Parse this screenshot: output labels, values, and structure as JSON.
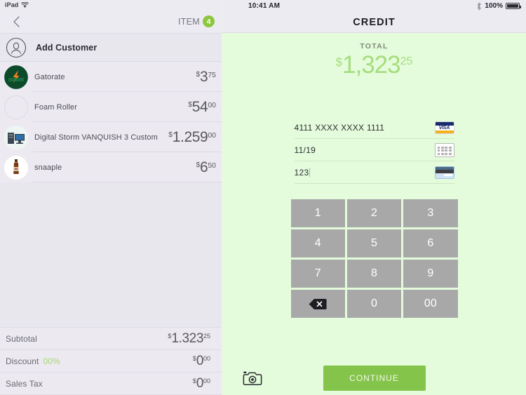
{
  "left_panel": {
    "status": {
      "device": "iPad",
      "wifi_icon": "wifi-icon"
    },
    "header": {
      "back_icon": "chevron-left-icon",
      "item_label": "ITEM",
      "item_count": "4"
    },
    "add_customer": {
      "label": "Add Customer",
      "icon": "person-circle-icon"
    },
    "cart_items": [
      {
        "name": "Gatorate",
        "currency": "$",
        "amount": "3",
        "cents": "75",
        "thumb": "gatorade-logo-thumb"
      },
      {
        "name": "Foam Roller",
        "currency": "$",
        "amount": "54",
        "cents": "00",
        "thumb": "empty-circle-thumb"
      },
      {
        "name": "Digital Storm VANQUISH 3 Custom",
        "currency": "$",
        "amount": "1.259",
        "cents": "00",
        "thumb": "desktop-pc-thumb"
      },
      {
        "name": "snaaple",
        "currency": "$",
        "amount": "6",
        "cents": "50",
        "thumb": "bottle-thumb"
      }
    ],
    "totals": [
      {
        "label": "Subtotal",
        "extra": "",
        "currency": "$",
        "amount": "1.323",
        "cents": "25"
      },
      {
        "label": "Discount",
        "extra": "00%",
        "currency": "$",
        "amount": "0",
        "cents": "00"
      },
      {
        "label": "Sales Tax",
        "extra": "",
        "currency": "$",
        "amount": "0",
        "cents": "00"
      }
    ]
  },
  "right_panel": {
    "status": {
      "time": "10:41 AM",
      "bluetooth_icon": "bluetooth-icon",
      "battery_percent": "100%"
    },
    "title": "CREDIT",
    "total": {
      "caption": "TOTAL",
      "currency": "$",
      "amount": "1,323",
      "cents": "25"
    },
    "fields": [
      {
        "value": "4111 XXXX XXXX 1111",
        "icon": "visa-card-icon",
        "has_cursor": false
      },
      {
        "value": "11/19",
        "icon": "calendar-icon",
        "has_cursor": false
      },
      {
        "value": "123",
        "icon": "card-back-cvv-icon",
        "has_cursor": true
      }
    ],
    "keypad": [
      {
        "label": "1",
        "name": "key-1"
      },
      {
        "label": "2",
        "name": "key-2"
      },
      {
        "label": "3",
        "name": "key-3"
      },
      {
        "label": "4",
        "name": "key-4"
      },
      {
        "label": "5",
        "name": "key-5"
      },
      {
        "label": "6",
        "name": "key-6"
      },
      {
        "label": "7",
        "name": "key-7"
      },
      {
        "label": "8",
        "name": "key-8"
      },
      {
        "label": "9",
        "name": "key-9"
      },
      {
        "label": "",
        "name": "key-backspace"
      },
      {
        "label": "0",
        "name": "key-0"
      },
      {
        "label": "00",
        "name": "key-double-zero"
      }
    ],
    "camera_icon": "camera-icon",
    "continue_label": "CONTINUE"
  },
  "colors": {
    "accent_green": "#8dc63f",
    "continue_green": "#85c44a",
    "total_green": "#a6dd7e",
    "panel_green_bg": "#e4fcdb",
    "left_bg": "#e9e7ee",
    "key_gray": "#a8a8a8"
  }
}
